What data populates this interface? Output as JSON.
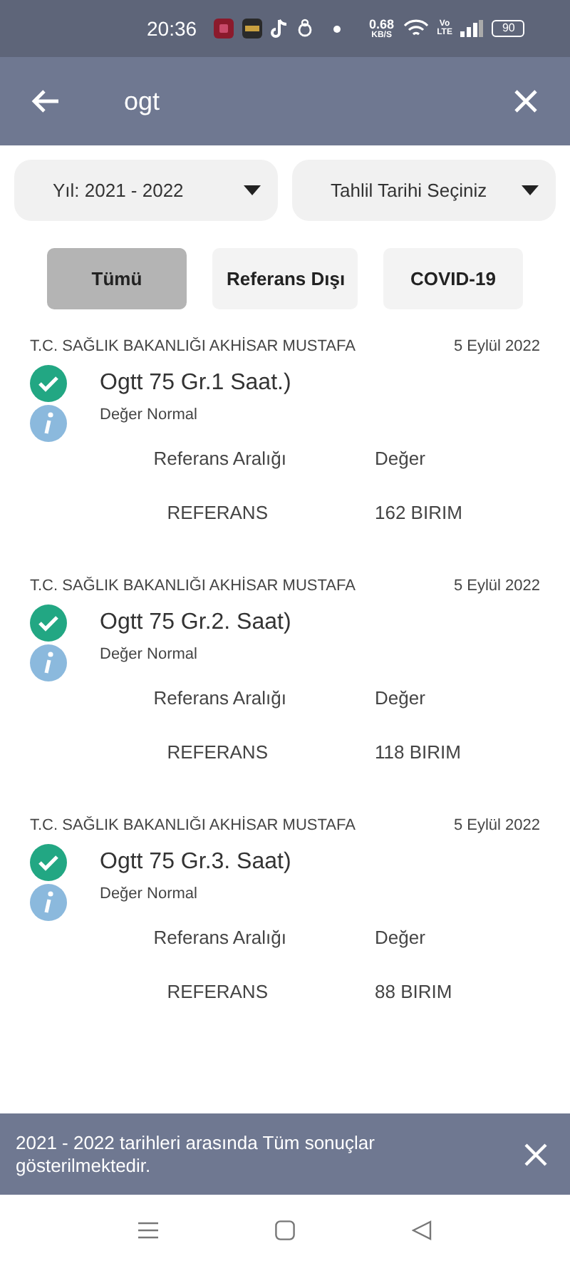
{
  "status_bar": {
    "time": "20:36",
    "net_speed": "0.68",
    "net_unit": "KB/S",
    "network_top": "Vo",
    "network_bottom": "LTE",
    "battery": "90"
  },
  "search": {
    "value": "ogt"
  },
  "filters": [
    {
      "label": "Yıl: 2021 - 2022"
    },
    {
      "label": "Tahlil Tarihi Seçiniz"
    }
  ],
  "tabs": [
    {
      "label": "Tümü",
      "selected": true
    },
    {
      "label": "Referans Dışı",
      "selected": false
    },
    {
      "label": "COVID-19",
      "selected": false
    }
  ],
  "results": [
    {
      "institution": "T.C. SAĞLIK BAKANLIĞI AKHİSAR MUSTAFA",
      "date": "5 Eylül 2022",
      "test": "Ogtt 75 Gr.1 Saat.)",
      "status": "Değer Normal",
      "normal": true,
      "col_ref": "Referans Aralığı",
      "col_value": "Değer",
      "reference": "REFERANS",
      "value": "162 BIRIM"
    },
    {
      "institution": "T.C. SAĞLIK BAKANLIĞI AKHİSAR MUSTAFA",
      "date": "5 Eylül 2022",
      "test": "Ogtt 75 Gr.2. Saat)",
      "status": "Değer Normal",
      "normal": true,
      "col_ref": "Referans Aralığı",
      "col_value": "Değer",
      "reference": "REFERANS",
      "value": "118 BIRIM"
    },
    {
      "institution": "T.C. SAĞLIK BAKANLIĞI AKHİSAR MUSTAFA",
      "date": "5 Eylül 2022",
      "test": "Ogtt 75 Gr.3. Saat)",
      "status": "Değer Normal",
      "normal": true,
      "col_ref": "Referans Aralığı",
      "col_value": "Değer",
      "reference": "REFERANS",
      "value": "88 BIRIM"
    }
  ],
  "snackbar": {
    "message": "2021 - 2022 tarihleri arasında Tüm sonuçlar gösterilmektedir."
  }
}
